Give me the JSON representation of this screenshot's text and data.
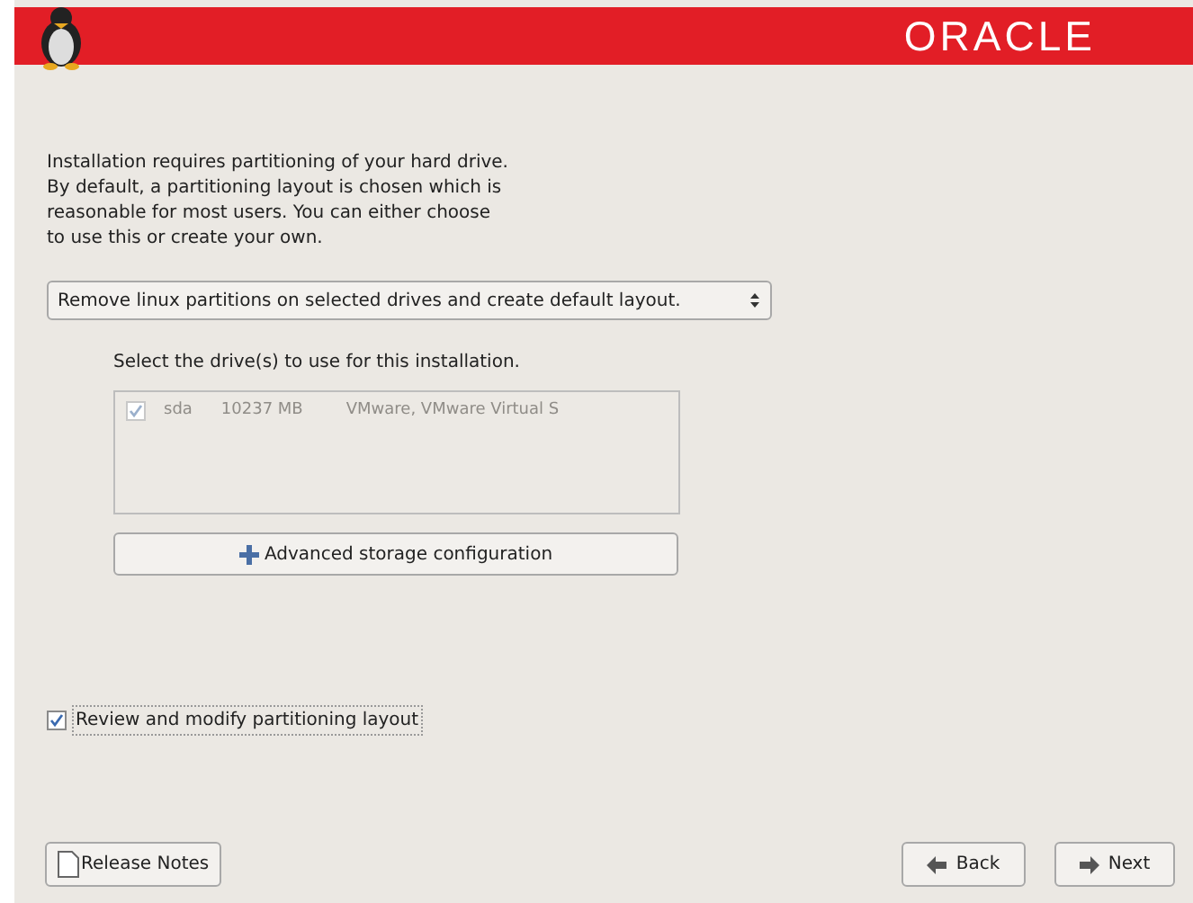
{
  "header": {
    "logo": "ORACLE"
  },
  "intro": "Installation requires partitioning of your hard drive.\nBy default, a partitioning layout is chosen which is\nreasonable for most users.  You can either choose\nto use this or create your own.",
  "layout_select": {
    "value": "Remove linux partitions on selected drives and create default layout."
  },
  "drives": {
    "label": "Select the drive(s) to use for this installation.",
    "disabled": true,
    "rows": [
      {
        "checked": true,
        "name": "sda",
        "size": "10237 MB",
        "model": "VMware, VMware Virtual S"
      }
    ]
  },
  "advanced_button": "Advanced storage configuration",
  "review": {
    "label": "Review and modify partitioning layout",
    "checked": true
  },
  "buttons": {
    "release_notes": "Release Notes",
    "back": "Back",
    "next": "Next"
  }
}
